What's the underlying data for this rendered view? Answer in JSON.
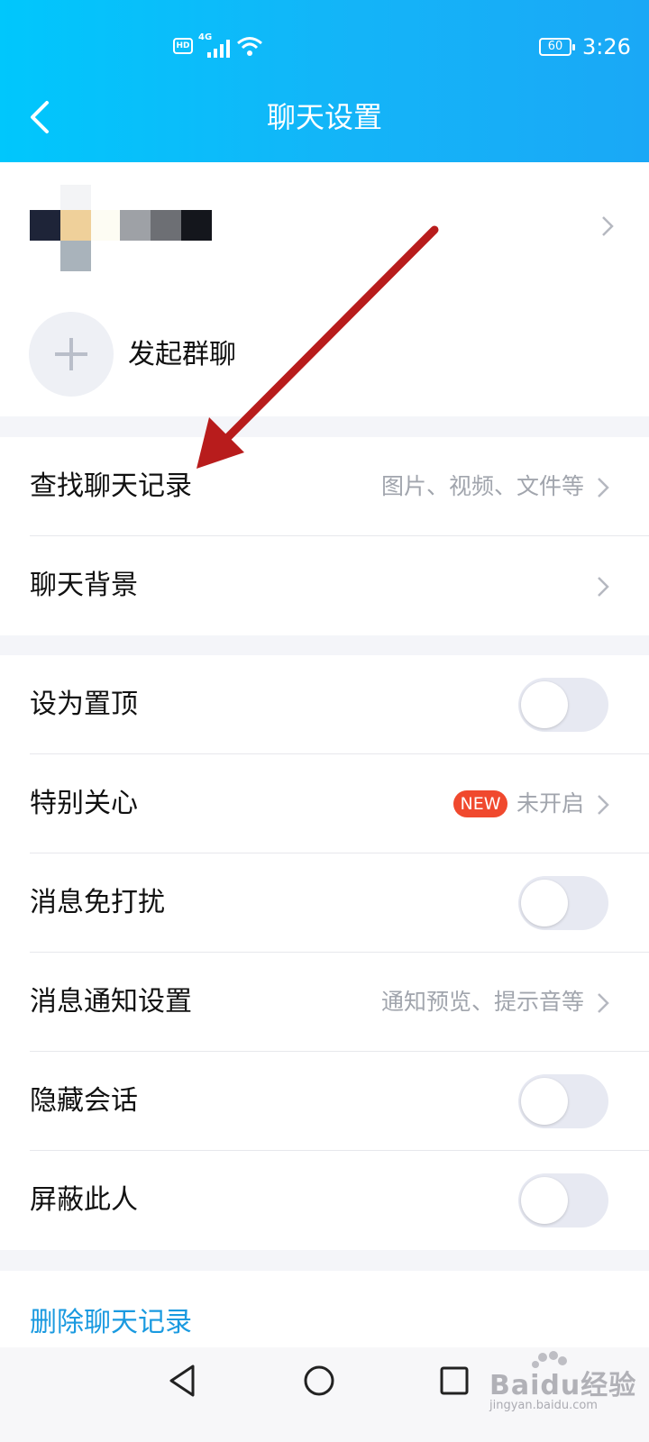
{
  "status_bar": {
    "hd": "HD",
    "network": "4G",
    "battery": "60",
    "time": "3:26"
  },
  "header": {
    "title": "聊天设置"
  },
  "profile": {
    "start_group_label": "发起群聊"
  },
  "section1": {
    "search_history": {
      "label": "查找聊天记录",
      "sub": "图片、视频、文件等"
    },
    "chat_background": {
      "label": "聊天背景"
    }
  },
  "section2": {
    "pin_top": {
      "label": "设为置顶",
      "on": false
    },
    "special_care": {
      "label": "特别关心",
      "badge": "NEW",
      "sub": "未开启"
    },
    "do_not_disturb": {
      "label": "消息免打扰",
      "on": false
    },
    "notification_settings": {
      "label": "消息通知设置",
      "sub": "通知预览、提示音等"
    },
    "hide_chat": {
      "label": "隐藏会话",
      "on": false
    },
    "block_user": {
      "label": "屏蔽此人",
      "on": false
    }
  },
  "delete_history": {
    "label": "删除聊天记录"
  },
  "watermark": {
    "brand": "Baidu经验",
    "url": "jingyan.baidu.com"
  },
  "colors": {
    "header_start": "#00c7fc",
    "header_end": "#1aa8f6",
    "accent_link": "#1a9ae0",
    "badge": "#f0492e",
    "annotation_arrow": "#b81c1c"
  }
}
